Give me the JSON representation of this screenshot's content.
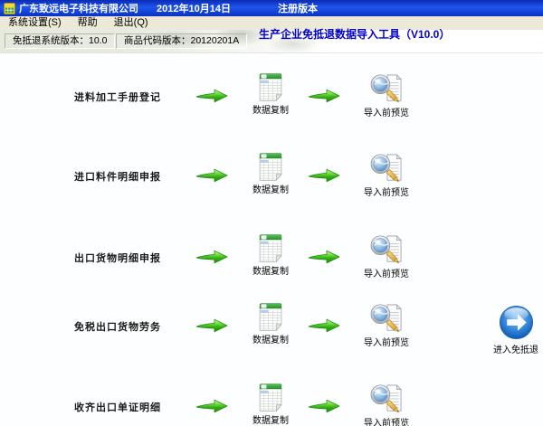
{
  "window": {
    "title_company": "广东致远电子科技有限公司",
    "title_date": "2012年10月14日",
    "title_edition": "注册版本"
  },
  "menu": {
    "items": [
      {
        "label": "系统设置(S)"
      },
      {
        "label": "帮助"
      },
      {
        "label": "退出(Q)"
      }
    ]
  },
  "header": {
    "system_version": "免抵退系统版本：10.0",
    "product_code_version": "商品代码版本：20120201A",
    "app_title": "生产企业免抵退数据导入工具（V10.0）"
  },
  "tasks": [
    {
      "label": "进料加工手册登记"
    },
    {
      "label": "进口料件明细申报"
    },
    {
      "label": "出口货物明细申报"
    },
    {
      "label": "免税出口货物劳务"
    },
    {
      "label": "收齐出口单证明细"
    }
  ],
  "actions": {
    "copy_label": "数据复制",
    "preview_label": "导入前预览",
    "enter_label": "进入免抵退"
  },
  "icons": {
    "app": "app-icon",
    "task_arrow": "green-arrow-icon",
    "copy": "spreadsheet-icon",
    "preview": "magnifier-document-icon",
    "enter": "enter-circle-arrow-icon"
  },
  "colors": {
    "titlebar_blue": "#0D35D2",
    "menu_bg": "#ECE9D8",
    "heading_blue": "#0000CC",
    "arrow_green": "#38B318",
    "enter_button_blue": "#2E7FD6"
  }
}
